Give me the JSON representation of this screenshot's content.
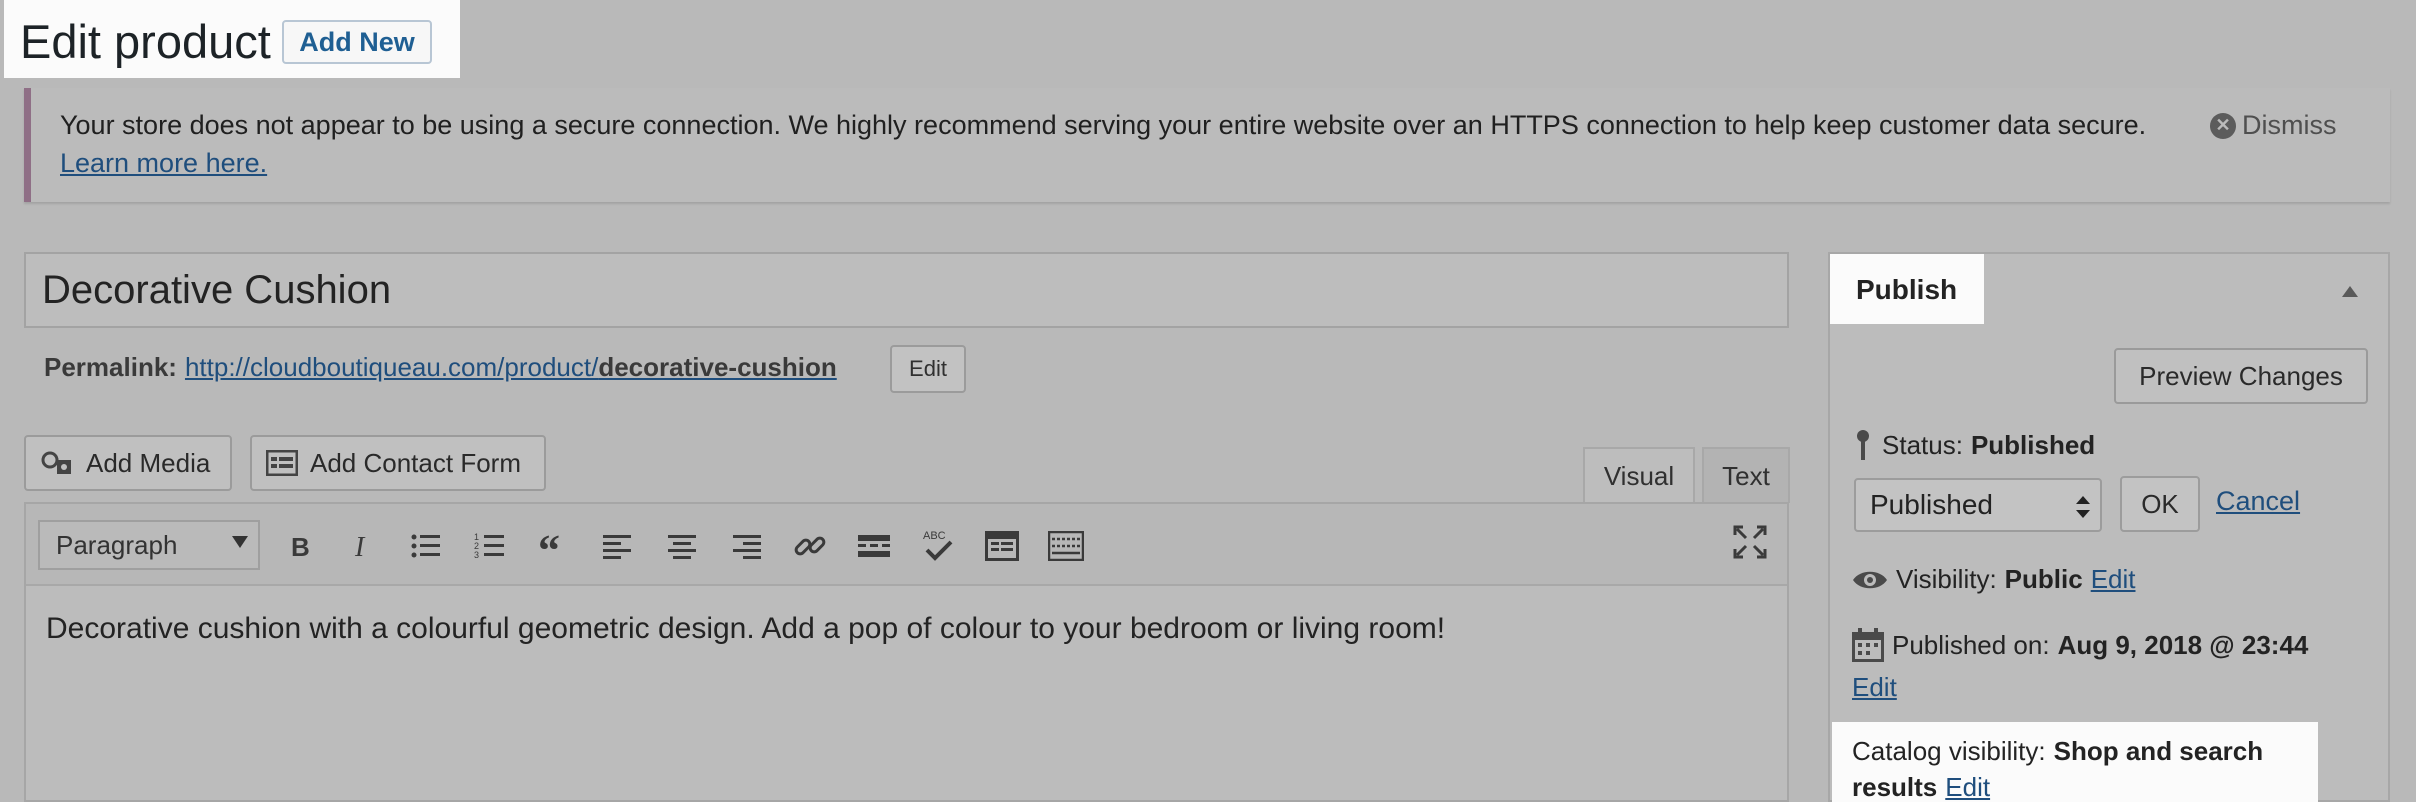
{
  "header": {
    "title": "Edit product",
    "add_new_label": "Add New"
  },
  "notice": {
    "text": "Your store does not appear to be using a secure connection. We highly recommend serving your entire website over an HTTPS connection to help keep customer data secure.",
    "link": "Learn more here.",
    "dismiss_label": "Dismiss"
  },
  "product": {
    "title": "Decorative Cushion",
    "permalink_label": "Permalink:",
    "permalink_base": "http://cloudboutiqueau.com/product/",
    "permalink_slug": "decorative-cushion",
    "permalink_edit_label": "Edit"
  },
  "media_buttons": {
    "add_media": "Add Media",
    "add_contact_form": "Add Contact Form"
  },
  "editor": {
    "tabs": {
      "visual": "Visual",
      "text": "Text"
    },
    "format_selected": "Paragraph",
    "content": "Decorative cushion with a colourful geometric design. Add a pop of colour to your bedroom or living room!",
    "toolbar_icons": [
      "bold-icon",
      "italic-icon",
      "bullet-list-icon",
      "numbered-list-icon",
      "blockquote-icon",
      "align-left-icon",
      "align-center-icon",
      "align-right-icon",
      "link-icon",
      "read-more-icon",
      "spellcheck-icon",
      "toolbar-toggle-icon",
      "keyboard-icon",
      "fullscreen-icon"
    ],
    "spellcheck_abc": "ABC"
  },
  "publish": {
    "title": "Publish",
    "preview_label": "Preview Changes",
    "status_label": "Status:",
    "status_value": "Published",
    "status_selected": "Published",
    "ok_label": "OK",
    "cancel_label": "Cancel",
    "visibility_label": "Visibility:",
    "visibility_value": "Public",
    "visibility_edit": "Edit",
    "published_on_label": "Published on:",
    "published_on_value": "Aug 9, 2018 @ 23:44",
    "published_on_edit": "Edit",
    "catalog_label": "Catalog visibility:",
    "catalog_value_line1": "Shop and search",
    "catalog_value_line2": "results",
    "catalog_edit": "Edit"
  }
}
